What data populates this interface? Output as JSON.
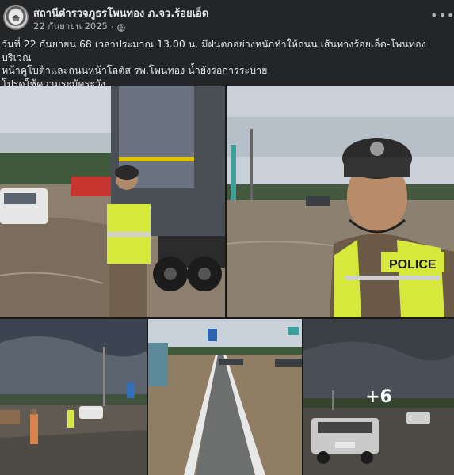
{
  "post": {
    "page_name": "สถานีตำรวจภูธรโพนทอง ภ.จว.ร้อยเอ็ด",
    "date": "22 กันยายน 2025",
    "dot": "·",
    "audience_icon": "globe-icon",
    "more_icon": "•••",
    "text_line1": "วันที่ 22 กันยายน 68 เวลาประมาณ 13.00 น. มีฝนตกอย่างหนักทำให้ถนน เส้นทางร้อยเอ็ด-โพนทอง บริเวณ",
    "text_line2": "หน้าคูโบต้าและถนนหน้าโลตัส รพ.โพนทอง น้ำยังรอการระบาย",
    "text_line3": "โปรดใช้ความระมัดระวัง"
  },
  "photos": {
    "more_count_label": "+6",
    "vest_text": "POLICE"
  },
  "colors": {
    "background": "#242526",
    "text": "#e4e6eb",
    "secondary_text": "#b0b3b8",
    "vest": "#d6e83a"
  }
}
